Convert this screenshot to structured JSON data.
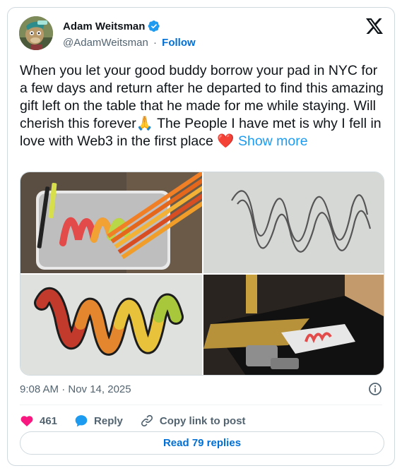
{
  "author": {
    "name": "Adam Weitsman",
    "handle": "@AdamWeitsman",
    "separator": "·",
    "follow_label": "Follow"
  },
  "tweet": {
    "text": "When you let your good buddy borrow your pad in NYC for a few days and return after he departed to find this amazing gift left on the table that he made for me while staying. Will cherish this forever🙏 The People I have met is why I fell in love with Web3 in the first place ❤️",
    "show_more_label": "Show more"
  },
  "media": [
    {
      "name": "photo-1"
    },
    {
      "name": "photo-2"
    },
    {
      "name": "photo-3"
    },
    {
      "name": "photo-4"
    }
  ],
  "meta": {
    "timestamp": "9:08 AM · Nov 14, 2025"
  },
  "actions": {
    "like_count": "461",
    "reply_label": "Reply",
    "copy_link_label": "Copy link to post"
  },
  "read_replies_label": "Read 79 replies",
  "colors": {
    "link": "#006fd6",
    "show_more": "#1d9bf0",
    "like": "#f91880",
    "text": "#0f1419",
    "secondary": "#536471",
    "border": "#cfd9de"
  },
  "icons": {
    "verified": "verified-badge-icon",
    "logo": "x-logo-icon",
    "info": "info-icon",
    "like": "heart-icon",
    "reply": "speech-bubble-icon",
    "copy_link": "link-icon"
  }
}
